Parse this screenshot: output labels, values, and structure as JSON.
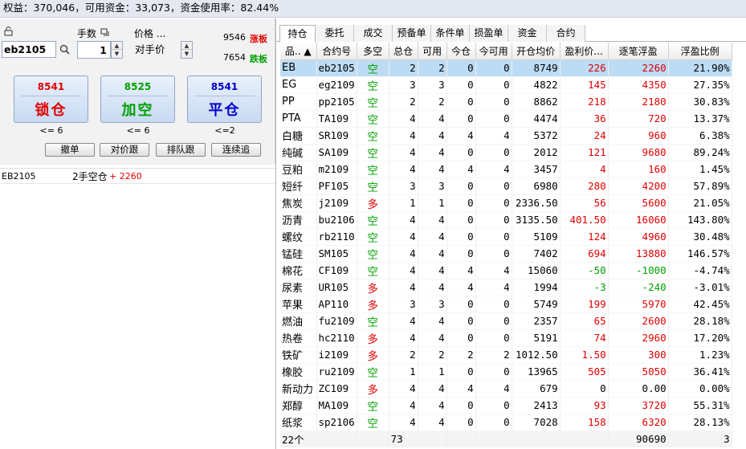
{
  "status_bar": {
    "text": "权益：370,046，可用资金：33,073，资金使用率：82.44%"
  },
  "order_panel": {
    "qty_label": "手数",
    "price_label": "价格 ...",
    "code_value": "eb2105",
    "qty_value": "1",
    "price_type": "对手价",
    "limit_up_value": "9546",
    "limit_up_label": "涨板",
    "limit_down_value": "7654",
    "limit_down_label": "跌板",
    "buttons": [
      {
        "price": "8541",
        "label": "锁仓",
        "cond": "<= 6",
        "price_color": "#e00000",
        "label_color": "#e00000"
      },
      {
        "price": "8525",
        "label": "加空",
        "cond": "<= 6",
        "price_color": "#00a000",
        "label_color": "#00a000"
      },
      {
        "price": "8541",
        "label": "平仓",
        "cond": "<=2",
        "price_color": "#0000cc",
        "label_color": "#0000cc"
      }
    ],
    "small_buttons": [
      "撤单",
      "对价跟",
      "排队跟",
      "连续追"
    ],
    "summary": {
      "code": "EB2105",
      "position": "2手空仓",
      "pnl": "+ 2260"
    }
  },
  "tabs": [
    "持仓",
    "委托",
    "成交",
    "预备单",
    "条件单",
    "损盈单",
    "资金",
    "合约"
  ],
  "active_tab": 0,
  "grid": {
    "headers": [
      "品.. ▲",
      "合约号",
      "多空",
      "总仓",
      "可用",
      "今仓",
      "今可用",
      "开仓均价",
      "盈利价...",
      "逐笔浮盈",
      "浮盈比例"
    ],
    "rows": [
      {
        "name": "EB",
        "code": "eb2105",
        "dir": "空",
        "total": "2",
        "avail": "2",
        "today": "0",
        "today_avail": "0",
        "open_avg": "8749",
        "profit_px": "226",
        "float_pnl": "2260",
        "ratio": "21.90%",
        "sign": "pos"
      },
      {
        "name": "EG",
        "code": "eg2109",
        "dir": "空",
        "total": "3",
        "avail": "3",
        "today": "0",
        "today_avail": "0",
        "open_avg": "4822",
        "profit_px": "145",
        "float_pnl": "4350",
        "ratio": "27.35%",
        "sign": "pos"
      },
      {
        "name": "PP",
        "code": "pp2105",
        "dir": "空",
        "total": "2",
        "avail": "2",
        "today": "0",
        "today_avail": "0",
        "open_avg": "8862",
        "profit_px": "218",
        "float_pnl": "2180",
        "ratio": "30.83%",
        "sign": "pos"
      },
      {
        "name": "PTA",
        "code": "TA109",
        "dir": "空",
        "total": "4",
        "avail": "4",
        "today": "0",
        "today_avail": "0",
        "open_avg": "4474",
        "profit_px": "36",
        "float_pnl": "720",
        "ratio": "13.37%",
        "sign": "pos"
      },
      {
        "name": "白糖",
        "code": "SR109",
        "dir": "空",
        "total": "4",
        "avail": "4",
        "today": "4",
        "today_avail": "4",
        "open_avg": "5372",
        "profit_px": "24",
        "float_pnl": "960",
        "ratio": "6.38%",
        "sign": "pos"
      },
      {
        "name": "纯碱",
        "code": "SA109",
        "dir": "空",
        "total": "4",
        "avail": "4",
        "today": "0",
        "today_avail": "0",
        "open_avg": "2012",
        "profit_px": "121",
        "float_pnl": "9680",
        "ratio": "89.24%",
        "sign": "pos"
      },
      {
        "name": "豆粕",
        "code": "m2109",
        "dir": "空",
        "total": "4",
        "avail": "4",
        "today": "4",
        "today_avail": "4",
        "open_avg": "3457",
        "profit_px": "4",
        "float_pnl": "160",
        "ratio": "1.45%",
        "sign": "pos"
      },
      {
        "name": "短纤",
        "code": "PF105",
        "dir": "空",
        "total": "3",
        "avail": "3",
        "today": "0",
        "today_avail": "0",
        "open_avg": "6980",
        "profit_px": "280",
        "float_pnl": "4200",
        "ratio": "57.89%",
        "sign": "pos"
      },
      {
        "name": "焦炭",
        "code": "j2109",
        "dir": "多",
        "total": "1",
        "avail": "1",
        "today": "0",
        "today_avail": "0",
        "open_avg": "2336.50",
        "profit_px": "56",
        "float_pnl": "5600",
        "ratio": "21.05%",
        "sign": "pos"
      },
      {
        "name": "沥青",
        "code": "bu2106",
        "dir": "空",
        "total": "4",
        "avail": "4",
        "today": "0",
        "today_avail": "0",
        "open_avg": "3135.50",
        "profit_px": "401.50",
        "float_pnl": "16060",
        "ratio": "143.80%",
        "sign": "pos"
      },
      {
        "name": "螺纹",
        "code": "rb2110",
        "dir": "空",
        "total": "4",
        "avail": "4",
        "today": "0",
        "today_avail": "0",
        "open_avg": "5109",
        "profit_px": "124",
        "float_pnl": "4960",
        "ratio": "30.48%",
        "sign": "pos"
      },
      {
        "name": "锰硅",
        "code": "SM105",
        "dir": "空",
        "total": "4",
        "avail": "4",
        "today": "0",
        "today_avail": "0",
        "open_avg": "7402",
        "profit_px": "694",
        "float_pnl": "13880",
        "ratio": "146.57%",
        "sign": "pos"
      },
      {
        "name": "棉花",
        "code": "CF109",
        "dir": "空",
        "total": "4",
        "avail": "4",
        "today": "4",
        "today_avail": "4",
        "open_avg": "15060",
        "profit_px": "-50",
        "float_pnl": "-1000",
        "ratio": "-4.74%",
        "sign": "neg"
      },
      {
        "name": "尿素",
        "code": "UR105",
        "dir": "多",
        "total": "4",
        "avail": "4",
        "today": "4",
        "today_avail": "4",
        "open_avg": "1994",
        "profit_px": "-3",
        "float_pnl": "-240",
        "ratio": "-3.01%",
        "sign": "neg"
      },
      {
        "name": "苹果",
        "code": "AP110",
        "dir": "多",
        "total": "3",
        "avail": "3",
        "today": "0",
        "today_avail": "0",
        "open_avg": "5749",
        "profit_px": "199",
        "float_pnl": "5970",
        "ratio": "42.45%",
        "sign": "pos"
      },
      {
        "name": "燃油",
        "code": "fu2109",
        "dir": "空",
        "total": "4",
        "avail": "4",
        "today": "0",
        "today_avail": "0",
        "open_avg": "2357",
        "profit_px": "65",
        "float_pnl": "2600",
        "ratio": "28.18%",
        "sign": "pos"
      },
      {
        "name": "热卷",
        "code": "hc2110",
        "dir": "多",
        "total": "4",
        "avail": "4",
        "today": "0",
        "today_avail": "0",
        "open_avg": "5191",
        "profit_px": "74",
        "float_pnl": "2960",
        "ratio": "17.20%",
        "sign": "pos"
      },
      {
        "name": "铁矿",
        "code": "i2109",
        "dir": "多",
        "total": "2",
        "avail": "2",
        "today": "2",
        "today_avail": "2",
        "open_avg": "1012.50",
        "profit_px": "1.50",
        "float_pnl": "300",
        "ratio": "1.23%",
        "sign": "pos"
      },
      {
        "name": "橡胶",
        "code": "ru2109",
        "dir": "空",
        "total": "1",
        "avail": "1",
        "today": "0",
        "today_avail": "0",
        "open_avg": "13965",
        "profit_px": "505",
        "float_pnl": "5050",
        "ratio": "36.41%",
        "sign": "pos"
      },
      {
        "name": "新动力",
        "code": "ZC109",
        "dir": "多",
        "total": "4",
        "avail": "4",
        "today": "4",
        "today_avail": "4",
        "open_avg": "679",
        "profit_px": "0",
        "float_pnl": "0.00",
        "ratio": "0.00%",
        "sign": "zero"
      },
      {
        "name": "郑醇",
        "code": "MA109",
        "dir": "空",
        "total": "4",
        "avail": "4",
        "today": "0",
        "today_avail": "0",
        "open_avg": "2413",
        "profit_px": "93",
        "float_pnl": "3720",
        "ratio": "55.31%",
        "sign": "pos"
      },
      {
        "name": "纸浆",
        "code": "sp2106",
        "dir": "空",
        "total": "4",
        "avail": "4",
        "today": "0",
        "today_avail": "0",
        "open_avg": "7028",
        "profit_px": "158",
        "float_pnl": "6320",
        "ratio": "28.13%",
        "sign": "pos"
      }
    ],
    "footer": {
      "count": "22个",
      "total": "73",
      "float_total": "90690",
      "extra": "3"
    }
  },
  "colors": {
    "profit": "#e00000",
    "loss": "#00a000",
    "long": "#e00000",
    "short": "#00a000",
    "selected_row": "#bcdcf5"
  }
}
